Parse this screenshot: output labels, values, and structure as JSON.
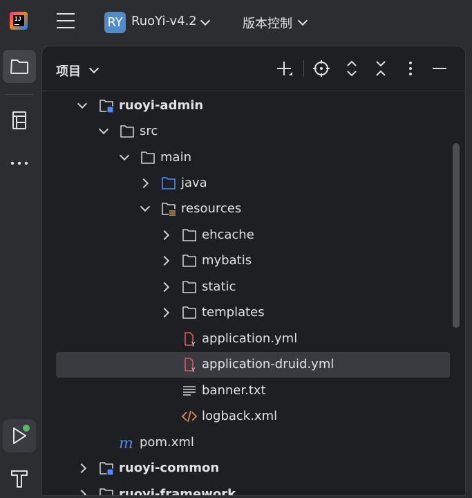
{
  "topbar": {
    "project_badge": "RY",
    "project_name": "RuoYi-v4.2",
    "vcs_label": "版本控制",
    "icons": [
      "app-logo-icon",
      "hamburger-menu-icon",
      "chevron-down-icon"
    ]
  },
  "toolstrip": {
    "icons": [
      "folder-icon",
      "structure-icon",
      "more-icon",
      "run-icon",
      "build-hammer-icon"
    ],
    "run_status_color": "#5fb865"
  },
  "panel": {
    "title": "项目",
    "header_icons": [
      "add-icon",
      "locate-icon",
      "expand-all-icon",
      "collapse-all-icon",
      "options-icon",
      "hide-icon"
    ]
  },
  "tree": [
    {
      "label": "ruoyi-admin",
      "type": "module",
      "expanded": true,
      "bold": true
    },
    {
      "label": "src",
      "type": "folder",
      "expanded": true
    },
    {
      "label": "main",
      "type": "folder",
      "expanded": true
    },
    {
      "label": "java",
      "type": "source-folder",
      "expanded": false
    },
    {
      "label": "resources",
      "type": "resource-folder",
      "expanded": true
    },
    {
      "label": "ehcache",
      "type": "folder",
      "expanded": false
    },
    {
      "label": "mybatis",
      "type": "folder",
      "expanded": false
    },
    {
      "label": "static",
      "type": "folder",
      "expanded": false
    },
    {
      "label": "templates",
      "type": "folder",
      "expanded": false
    },
    {
      "label": "application.yml",
      "type": "yaml-file"
    },
    {
      "label": "application-druid.yml",
      "type": "yaml-file",
      "selected": true
    },
    {
      "label": "banner.txt",
      "type": "text-file"
    },
    {
      "label": "logback.xml",
      "type": "xml-file"
    },
    {
      "label": "pom.xml",
      "type": "maven-file"
    },
    {
      "label": "ruoyi-common",
      "type": "module",
      "expanded": false,
      "bold": true
    },
    {
      "label": "ruoyi-framework",
      "type": "module",
      "expanded": false,
      "bold": true
    }
  ],
  "colors": {
    "background": "#2b2d30",
    "panel": "#1e1f22",
    "selection": "#393b40",
    "text": "#dfe1e5",
    "project_badge": "#4f8bc9",
    "source_folder": "#548af7",
    "yaml_icon": "#db5c5c",
    "xml_icon": "#e08855"
  }
}
